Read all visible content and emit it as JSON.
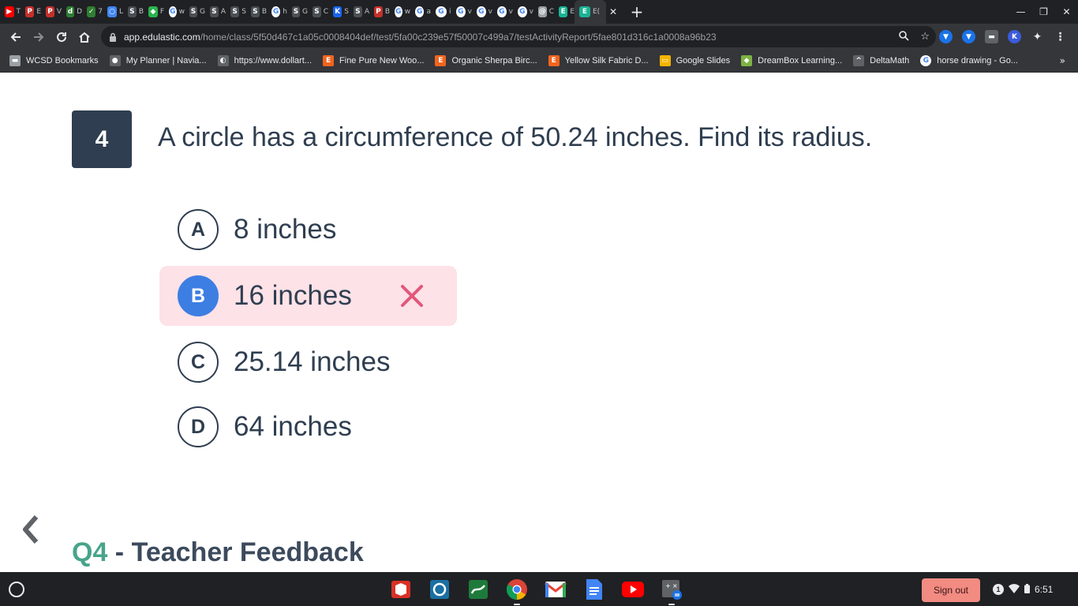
{
  "browser": {
    "tabs": [
      {
        "icon": "youtube-icon",
        "color": "#ff0000",
        "glyph": "▶",
        "letter": "T"
      },
      {
        "icon": "pbs-icon",
        "color": "#c4302b",
        "glyph": "P",
        "letter": "E"
      },
      {
        "icon": "pbs-icon",
        "color": "#c4302b",
        "glyph": "P",
        "letter": "V"
      },
      {
        "icon": "desmos-icon",
        "color": "#2e7d32",
        "glyph": "d",
        "letter": "D"
      },
      {
        "icon": "mathsite-icon",
        "color": "#2e7d32",
        "glyph": "✓",
        "letter": "7"
      },
      {
        "icon": "circle-icon",
        "color": "#4285f4",
        "glyph": "○",
        "letter": "L"
      },
      {
        "icon": "schoology-icon",
        "color": "#4a4f55",
        "glyph": "S",
        "letter": "B"
      },
      {
        "icon": "feedly-icon",
        "color": "#2bb24c",
        "glyph": "◆",
        "letter": "F"
      },
      {
        "icon": "google-icon",
        "color": "#ffffff",
        "glyph": "G",
        "letter": "w"
      },
      {
        "icon": "schoology-icon",
        "color": "#4a4f55",
        "glyph": "S",
        "letter": "G"
      },
      {
        "icon": "schoology-icon",
        "color": "#4a4f55",
        "glyph": "S",
        "letter": "A"
      },
      {
        "icon": "schoology-icon",
        "color": "#4a4f55",
        "glyph": "S",
        "letter": "S"
      },
      {
        "icon": "schoology-icon",
        "color": "#4a4f55",
        "glyph": "S",
        "letter": "B"
      },
      {
        "icon": "google-icon",
        "color": "#ffffff",
        "glyph": "G",
        "letter": "h"
      },
      {
        "icon": "schoology-icon",
        "color": "#4a4f55",
        "glyph": "S",
        "letter": "G"
      },
      {
        "icon": "schoology-icon",
        "color": "#4a4f55",
        "glyph": "S",
        "letter": "C"
      },
      {
        "icon": "khan-icon",
        "color": "#1865f2",
        "glyph": "K",
        "letter": "S"
      },
      {
        "icon": "schoology-icon",
        "color": "#4a4f55",
        "glyph": "S",
        "letter": "A"
      },
      {
        "icon": "pbs-icon",
        "color": "#c4302b",
        "glyph": "P",
        "letter": "B"
      },
      {
        "icon": "google-icon",
        "color": "#ffffff",
        "glyph": "G",
        "letter": "w"
      },
      {
        "icon": "google-icon",
        "color": "#ffffff",
        "glyph": "G",
        "letter": "a"
      },
      {
        "icon": "google-icon",
        "color": "#ffffff",
        "glyph": "G",
        "letter": "i"
      },
      {
        "icon": "google-icon",
        "color": "#ffffff",
        "glyph": "G",
        "letter": "v"
      },
      {
        "icon": "google-icon",
        "color": "#ffffff",
        "glyph": "G",
        "letter": "v"
      },
      {
        "icon": "google-icon",
        "color": "#ffffff",
        "glyph": "G",
        "letter": "v"
      },
      {
        "icon": "google-icon",
        "color": "#ffffff",
        "glyph": "G",
        "letter": "v"
      },
      {
        "icon": "spiral-icon",
        "color": "#9aa0a6",
        "glyph": "@",
        "letter": "C"
      },
      {
        "icon": "edulastic-icon",
        "color": "#1ab394",
        "glyph": "E",
        "letter": "E"
      }
    ],
    "active_tab": {
      "icon": "edulastic-icon",
      "letter": "E("
    },
    "url_host": "app.edulastic.com",
    "url_path": "/home/class/5f50d467c1a05c0008404def/test/5fa00c239e57f50007c499a7/testActivityReport/5fae801d316c1a0008a96b23",
    "bookmarks": [
      {
        "label": "WCSD Bookmarks",
        "icon": "folder-icon",
        "color": "#9aa0a6",
        "glyph": "▬"
      },
      {
        "label": "My Planner | Navia...",
        "icon": "navia-icon",
        "color": "#5f6368",
        "glyph": "●"
      },
      {
        "label": "https://www.dollart...",
        "icon": "globe-icon",
        "color": "#5f6368",
        "glyph": "◐"
      },
      {
        "label": "Fine Pure New Woo...",
        "icon": "etsy-icon",
        "color": "#f1641e",
        "glyph": "E"
      },
      {
        "label": "Organic Sherpa Birc...",
        "icon": "etsy-icon",
        "color": "#f1641e",
        "glyph": "E"
      },
      {
        "label": "Yellow Silk Fabric D...",
        "icon": "etsy-icon",
        "color": "#f1641e",
        "glyph": "E"
      },
      {
        "label": "Google Slides",
        "icon": "slides-icon",
        "color": "#f4b400",
        "glyph": "▭"
      },
      {
        "label": "DreamBox Learning...",
        "icon": "dreambox-icon",
        "color": "#7cb342",
        "glyph": "◆"
      },
      {
        "label": "DeltaMath",
        "icon": "deltamath-icon",
        "color": "#5f6368",
        "glyph": "^"
      },
      {
        "label": "horse drawing - Go...",
        "icon": "google-icon",
        "color": "#ffffff",
        "glyph": "G"
      }
    ],
    "bookmarks_more": "»"
  },
  "question": {
    "number": "4",
    "text": "A circle has a circumference of 50.24 inches. Find its radius.",
    "options": [
      {
        "letter": "A",
        "text": "8 inches",
        "state": "default"
      },
      {
        "letter": "B",
        "text": "16 inches",
        "state": "wrong"
      },
      {
        "letter": "C",
        "text": "25.14 inches",
        "state": "default"
      },
      {
        "letter": "D",
        "text": "64 inches",
        "state": "default"
      }
    ]
  },
  "feedback": {
    "qlabel": "Q4",
    "title": " - Teacher Feedback"
  },
  "colors": {
    "navy": "#2f3e50",
    "wrong_bg": "#fde2e7",
    "selected_blue": "#3d7ee3",
    "x_red": "#e3577b",
    "feedback_green": "#48a48a"
  },
  "shelf": {
    "apps": [
      "sketchup-icon",
      "camera-icon",
      "geogebra-icon",
      "chrome-icon",
      "gmail-icon",
      "docs-icon",
      "youtube-icon",
      "calculator-icon"
    ],
    "signout_label": "Sign out",
    "notification_count": "1",
    "time": "6:51"
  }
}
